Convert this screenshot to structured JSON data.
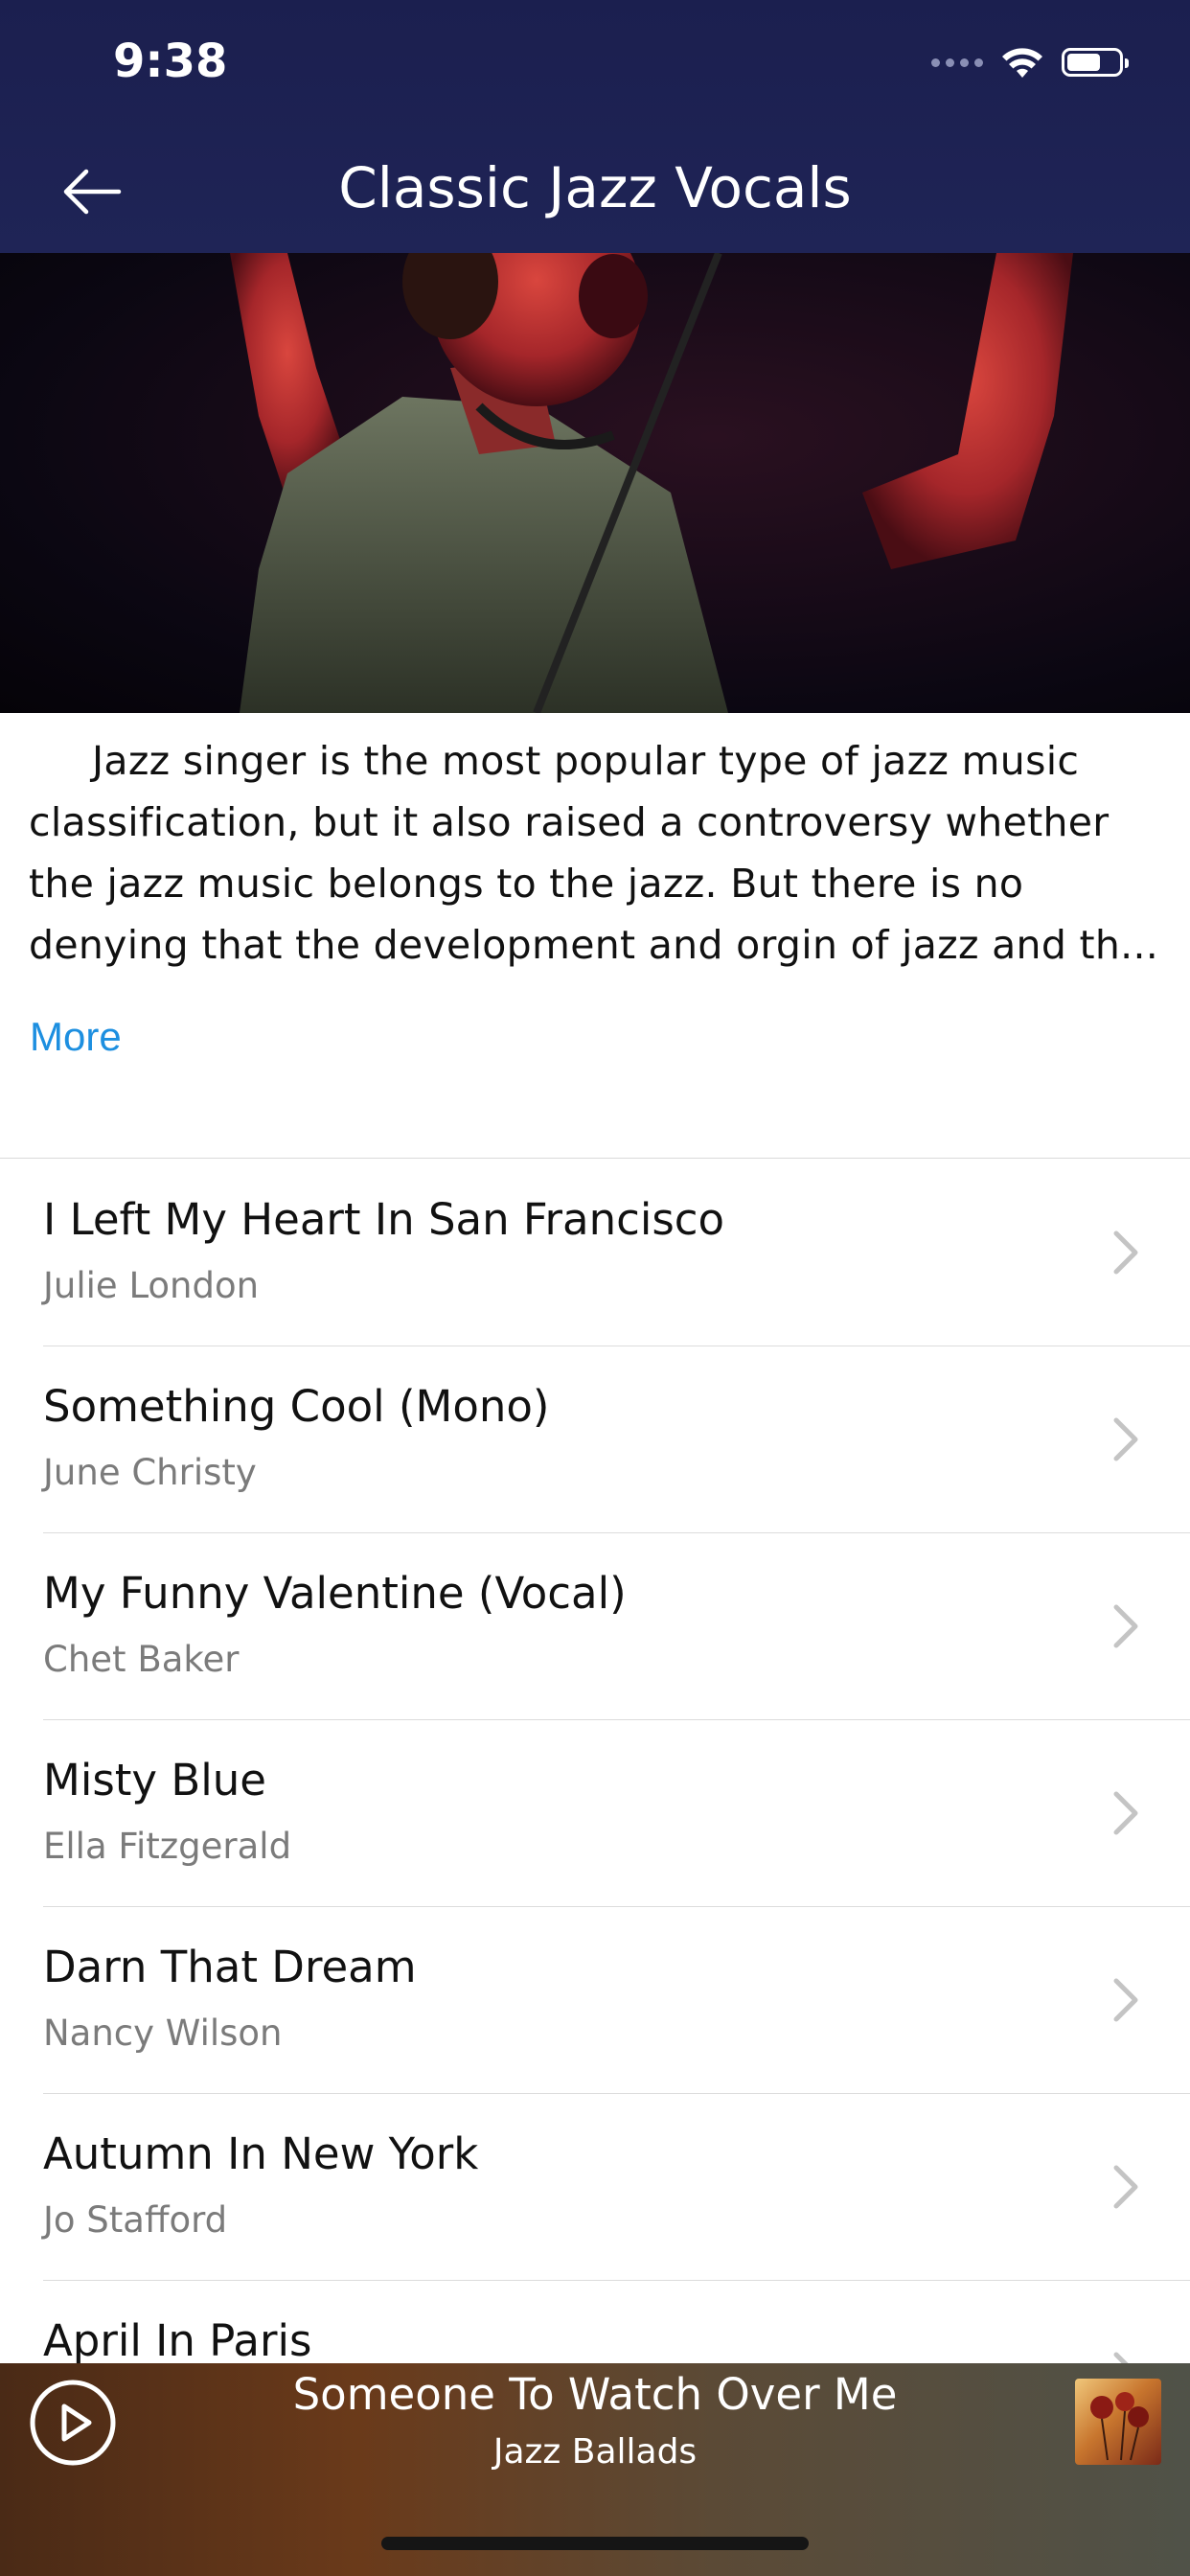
{
  "status_bar": {
    "time": "9:38"
  },
  "nav": {
    "title": "Classic Jazz Vocals"
  },
  "description": {
    "text": "Jazz singer is the most popular type of jazz music classification, but it also raised a controversy whether the jazz music belongs to the jazz. But there is no denying that the development and orgin of jazz and th...",
    "more_label": "More"
  },
  "tracks": [
    {
      "title": "I Left My Heart In San Francisco",
      "artist": "Julie London"
    },
    {
      "title": "Something Cool (Mono)",
      "artist": "June Christy"
    },
    {
      "title": "My Funny Valentine (Vocal)",
      "artist": "Chet Baker"
    },
    {
      "title": "Misty Blue",
      "artist": "Ella Fitzgerald"
    },
    {
      "title": "Darn That Dream",
      "artist": "Nancy Wilson"
    },
    {
      "title": "Autumn In New York",
      "artist": "Jo Stafford"
    },
    {
      "title": "April In Paris",
      "artist": ""
    }
  ],
  "player": {
    "title": "Someone To Watch Over Me",
    "subtitle": "Jazz Ballads"
  },
  "colors": {
    "header_bg": "#1b1f4f",
    "link": "#1d8fe0",
    "divider": "#dcdcdc"
  },
  "icons": {
    "back": "arrow-left-icon",
    "chevron": "chevron-right-icon",
    "play": "play-icon",
    "wifi": "wifi-icon",
    "battery": "battery-icon",
    "signal": "signal-icon"
  }
}
